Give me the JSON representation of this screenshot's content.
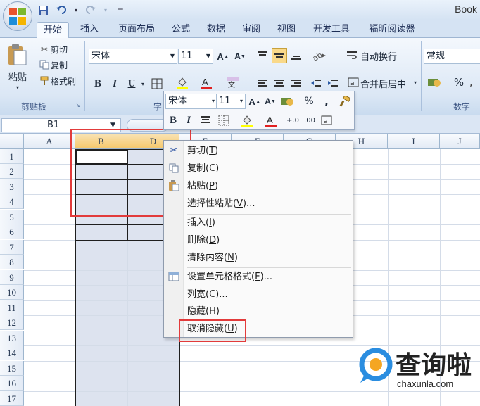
{
  "title": {
    "book": "Book"
  },
  "qat": {
    "save_icon": "save-icon",
    "undo_icon": "undo-icon",
    "redo_icon": "redo-icon",
    "more": "="
  },
  "tabs": [
    {
      "label": "开始",
      "active": true
    },
    {
      "label": "插入"
    },
    {
      "label": "页面布局"
    },
    {
      "label": "公式"
    },
    {
      "label": "数据"
    },
    {
      "label": "审阅"
    },
    {
      "label": "视图"
    },
    {
      "label": "开发工具"
    },
    {
      "label": "福昕阅读器"
    }
  ],
  "ribbon": {
    "clipboard": {
      "paste": "粘贴",
      "cut": "剪切",
      "copy": "复制",
      "format_painter": "格式刷",
      "group": "剪贴板"
    },
    "font": {
      "name": "宋体",
      "size": "11",
      "bold": "B",
      "italic": "I",
      "underline": "U",
      "group": "字"
    },
    "alignment": {
      "wrap": "自动换行",
      "merge": "合并后居中"
    },
    "number": {
      "format": "常规",
      "percent": "%",
      "group": "数字"
    }
  },
  "formula_bar": {
    "name_box": "B1"
  },
  "columns": [
    "A",
    "B",
    "D",
    "E",
    "F",
    "G",
    "H",
    "I",
    "J"
  ],
  "rows": [
    "1",
    "2",
    "3",
    "4",
    "5",
    "6",
    "7",
    "8",
    "9",
    "10",
    "11",
    "12",
    "13",
    "14",
    "15",
    "16",
    "17"
  ],
  "mini_toolbar": {
    "font": "宋体",
    "size": "11",
    "percent": "%",
    "comma": ",",
    "bold": "B",
    "italic": "I"
  },
  "context_menu": {
    "cut": {
      "text": "剪切(",
      "key": "T",
      "end": ")"
    },
    "copy": {
      "text": "复制(",
      "key": "C",
      "end": ")"
    },
    "paste": {
      "text": "粘贴(",
      "key": "P",
      "end": ")"
    },
    "paste_special": {
      "text": "选择性粘贴(",
      "key": "V",
      "end": ")..."
    },
    "insert": {
      "text": "插入(",
      "key": "I",
      "end": ")"
    },
    "delete": {
      "text": "删除(",
      "key": "D",
      "end": ")"
    },
    "clear": {
      "text": "清除内容(",
      "key": "N",
      "end": ")"
    },
    "format_cells": {
      "text": "设置单元格格式(",
      "key": "F",
      "end": ")..."
    },
    "col_width": {
      "text": "列宽(",
      "key": "C",
      "end": ")..."
    },
    "hide": {
      "text": "隐藏(",
      "key": "H",
      "end": ")"
    },
    "unhide": {
      "text": "取消隐藏(",
      "key": "U",
      "end": ")"
    }
  },
  "watermark": {
    "brand": "查询啦",
    "url": "chaxunla.com"
  }
}
